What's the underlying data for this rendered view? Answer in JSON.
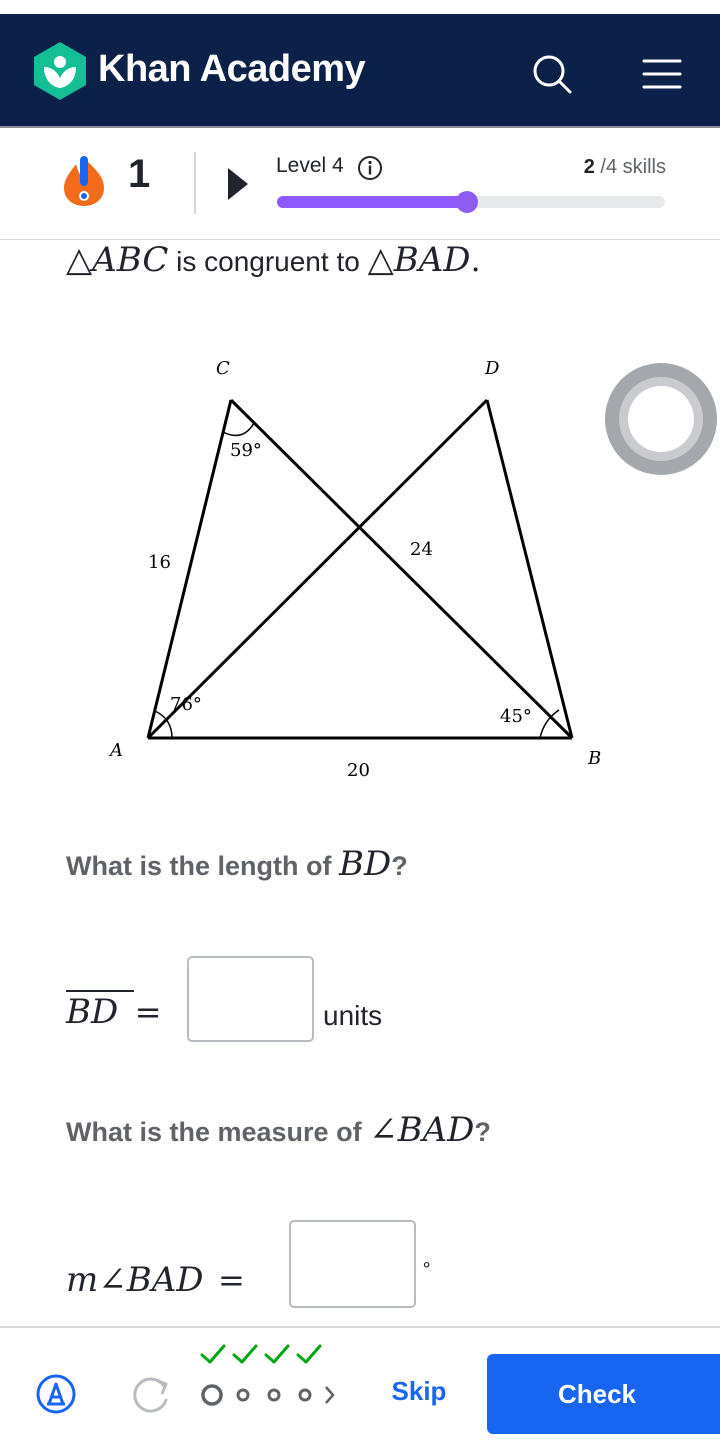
{
  "header": {
    "brand": "Khan Academy",
    "search_icon": "search-icon",
    "menu_icon": "hamburger-menu-icon",
    "logo_icon": "khan-academy-leaf-logo"
  },
  "progress": {
    "streak_count": "1",
    "level_label": "Level 4",
    "skills_done": "2",
    "skills_rest": "/4 skills",
    "level_fill": 0.49,
    "colors": {
      "fill": "#9059ff",
      "track": "#e8e9ea"
    }
  },
  "problem": {
    "tri1": "△ABC",
    "is_congruent_to": "is congruent to",
    "tri2": "△BAD",
    "period": "."
  },
  "figure": {
    "vertex_labels": {
      "C": "C",
      "D": "D",
      "A": "A",
      "B": "B"
    },
    "angle_labels": {
      "C": "59°",
      "A": "76°",
      "B": "45°"
    },
    "side_labels": {
      "AC": "16",
      "CB": "24",
      "AB": "20"
    }
  },
  "question1": {
    "prompt": "What is the length of",
    "segment": "BD",
    "qmark": "?",
    "lhs": "BD",
    "equals": "=",
    "units": "units",
    "value": ""
  },
  "question2": {
    "prompt": "What is the measure of",
    "angle": "∠BAD",
    "qmark": "?",
    "lhs": "m∠BAD",
    "equals": "=",
    "degree_symbol": "∘",
    "value": ""
  },
  "footer": {
    "skip_label": "Skip",
    "check_label": "Check",
    "attempts_checked": 4,
    "attempts_total": 4,
    "colors": {
      "primary": "#1865f2",
      "check": "#00a60e"
    }
  }
}
